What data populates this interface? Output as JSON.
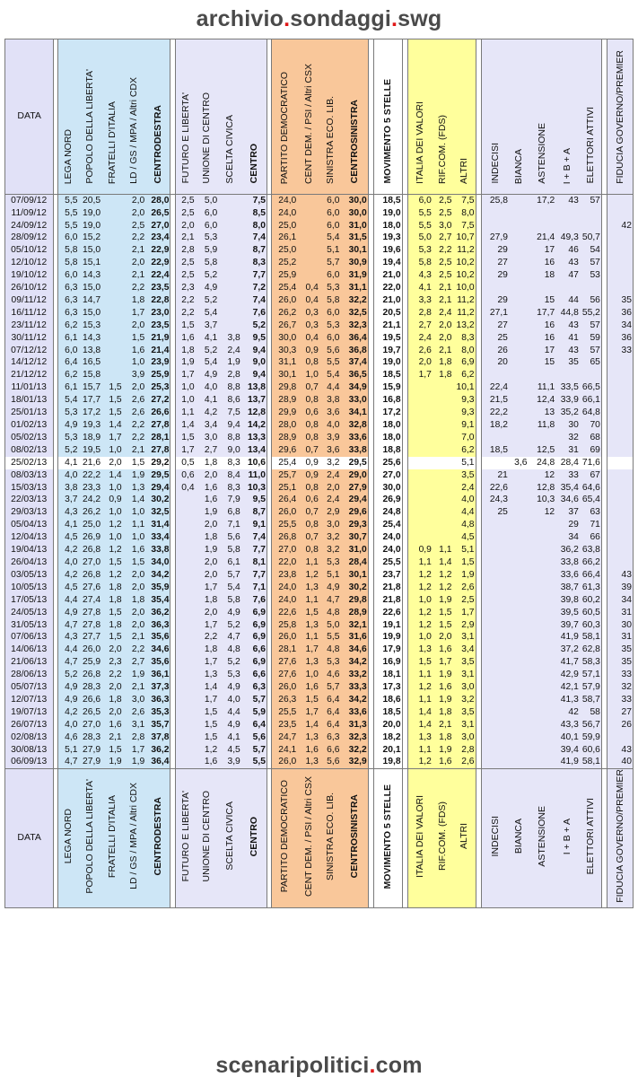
{
  "banner_top": {
    "a": "archivio",
    "dot1": ".",
    "b": "sondaggi",
    "dot2": ".",
    "c": "swg"
  },
  "banner_bottom": {
    "a": "scenaripolitici",
    "dot": ".",
    "b": "com"
  },
  "headers": {
    "date": "DATA",
    "cdx": [
      "LEGA NORD",
      "POPOLO DELLA LIBERTA'",
      "FRATELLI D'ITALIA",
      "LD / GS / MPA / Altri CDX",
      "CENTRODESTRA"
    ],
    "cen": [
      "FUTURO E LIBERTA'",
      "UNIONE DI CENTRO",
      "SCELTA CIVICA",
      "CENTRO"
    ],
    "csx": [
      "PARTITO DEMOCRATICO",
      "CENT DEM. / PSI / Altri CSX",
      "SINISTRA ECO. LIB.",
      "CENTROSINISTRA"
    ],
    "m5s": "MOVIMENTO 5 STELLE",
    "alt": [
      "ITALIA DEI VALORI",
      "RIF.COM. (FDS)",
      "ALTRI"
    ],
    "ast": [
      "INDECISI",
      "BIANCA",
      "ASTENSIONE",
      "I + B + A",
      "ELETTORI ATTIVI"
    ],
    "fid": "FIDUCIA GOVERNO/PREMIER"
  },
  "rows": [
    [
      "07/09/12",
      "5,5",
      "20,5",
      "",
      "2,0",
      "28,0",
      "2,5",
      "5,0",
      "",
      "7,5",
      "24,0",
      "",
      "6,0",
      "30,0",
      "18,5",
      "6,0",
      "2,5",
      "7,5",
      "25,8",
      "",
      "17,2",
      "43",
      "57",
      ""
    ],
    [
      "11/09/12",
      "5,5",
      "19,0",
      "",
      "2,0",
      "26,5",
      "2,5",
      "6,0",
      "",
      "8,5",
      "24,0",
      "",
      "6,0",
      "30,0",
      "19,0",
      "5,5",
      "2,5",
      "8,0",
      "",
      "",
      "",
      "",
      "",
      ""
    ],
    [
      "24/09/12",
      "5,5",
      "19,0",
      "",
      "2,5",
      "27,0",
      "2,0",
      "6,0",
      "",
      "8,0",
      "25,0",
      "",
      "6,0",
      "31,0",
      "18,0",
      "5,5",
      "3,0",
      "7,5",
      "",
      "",
      "",
      "",
      "",
      "42"
    ],
    [
      "28/09/12",
      "6,0",
      "15,2",
      "",
      "2,2",
      "23,4",
      "2,1",
      "5,3",
      "",
      "7,4",
      "26,1",
      "",
      "5,4",
      "31,5",
      "19,3",
      "5,0",
      "2,7",
      "10,7",
      "27,9",
      "",
      "21,4",
      "49,3",
      "50,7",
      ""
    ],
    [
      "05/10/12",
      "5,8",
      "15,0",
      "",
      "2,1",
      "22,9",
      "2,8",
      "5,9",
      "",
      "8,7",
      "25,0",
      "",
      "5,1",
      "30,1",
      "19,6",
      "5,3",
      "2,2",
      "11,2",
      "29",
      "",
      "17",
      "46",
      "54",
      ""
    ],
    [
      "12/10/12",
      "5,8",
      "15,1",
      "",
      "2,0",
      "22,9",
      "2,5",
      "5,8",
      "",
      "8,3",
      "25,2",
      "",
      "5,7",
      "30,9",
      "19,4",
      "5,8",
      "2,5",
      "10,2",
      "27",
      "",
      "16",
      "43",
      "57",
      ""
    ],
    [
      "19/10/12",
      "6,0",
      "14,3",
      "",
      "2,1",
      "22,4",
      "2,5",
      "5,2",
      "",
      "7,7",
      "25,9",
      "",
      "6,0",
      "31,9",
      "21,0",
      "4,3",
      "2,5",
      "10,2",
      "29",
      "",
      "18",
      "47",
      "53",
      ""
    ],
    [
      "26/10/12",
      "6,3",
      "15,0",
      "",
      "2,2",
      "23,5",
      "2,3",
      "4,9",
      "",
      "7,2",
      "25,4",
      "0,4",
      "5,3",
      "31,1",
      "22,0",
      "4,1",
      "2,1",
      "10,0",
      "",
      "",
      "",
      "",
      "",
      ""
    ],
    [
      "09/11/12",
      "6,3",
      "14,7",
      "",
      "1,8",
      "22,8",
      "2,2",
      "5,2",
      "",
      "7,4",
      "26,0",
      "0,4",
      "5,8",
      "32,2",
      "21,0",
      "3,3",
      "2,1",
      "11,2",
      "29",
      "",
      "15",
      "44",
      "56",
      "35"
    ],
    [
      "16/11/12",
      "6,3",
      "15,0",
      "",
      "1,7",
      "23,0",
      "2,2",
      "5,4",
      "",
      "7,6",
      "26,2",
      "0,3",
      "6,0",
      "32,5",
      "20,5",
      "2,8",
      "2,4",
      "11,2",
      "27,1",
      "",
      "17,7",
      "44,8",
      "55,2",
      "36"
    ],
    [
      "23/11/12",
      "6,2",
      "15,3",
      "",
      "2,0",
      "23,5",
      "1,5",
      "3,7",
      "",
      "5,2",
      "26,7",
      "0,3",
      "5,3",
      "32,3",
      "21,1",
      "2,7",
      "2,0",
      "13,2",
      "27",
      "",
      "16",
      "43",
      "57",
      "34"
    ],
    [
      "30/11/12",
      "6,1",
      "14,3",
      "",
      "1,5",
      "21,9",
      "1,6",
      "4,1",
      "3,8",
      "9,5",
      "30,0",
      "0,4",
      "6,0",
      "36,4",
      "19,5",
      "2,4",
      "2,0",
      "8,3",
      "25",
      "",
      "16",
      "41",
      "59",
      "36"
    ],
    [
      "07/12/12",
      "6,0",
      "13,8",
      "",
      "1,6",
      "21,4",
      "1,8",
      "5,2",
      "2,4",
      "9,4",
      "30,3",
      "0,9",
      "5,6",
      "36,8",
      "19,7",
      "2,6",
      "2,1",
      "8,0",
      "26",
      "",
      "17",
      "43",
      "57",
      "33"
    ],
    [
      "14/12/12",
      "6,4",
      "16,5",
      "",
      "1,0",
      "23,9",
      "1,9",
      "5,4",
      "1,9",
      "9,0",
      "31,1",
      "0,8",
      "5,5",
      "37,4",
      "19,0",
      "2,0",
      "1,8",
      "6,9",
      "20",
      "",
      "15",
      "35",
      "65",
      ""
    ],
    [
      "21/12/12",
      "6,2",
      "15,8",
      "",
      "3,9",
      "25,9",
      "1,7",
      "4,9",
      "2,8",
      "9,4",
      "30,1",
      "1,0",
      "5,4",
      "36,5",
      "18,5",
      "1,7",
      "1,8",
      "6,2",
      "",
      "",
      "",
      "",
      "",
      ""
    ],
    [
      "11/01/13",
      "6,1",
      "15,7",
      "1,5",
      "2,0",
      "25,3",
      "1,0",
      "4,0",
      "8,8",
      "13,8",
      "29,8",
      "0,7",
      "4,4",
      "34,9",
      "15,9",
      "",
      "",
      "10,1",
      "22,4",
      "",
      "11,1",
      "33,5",
      "66,5",
      ""
    ],
    [
      "18/01/13",
      "5,4",
      "17,7",
      "1,5",
      "2,6",
      "27,2",
      "1,0",
      "4,1",
      "8,6",
      "13,7",
      "28,9",
      "0,8",
      "3,8",
      "33,0",
      "16,8",
      "",
      "",
      "9,3",
      "21,5",
      "",
      "12,4",
      "33,9",
      "66,1",
      ""
    ],
    [
      "25/01/13",
      "5,3",
      "17,2",
      "1,5",
      "2,6",
      "26,6",
      "1,1",
      "4,2",
      "7,5",
      "12,8",
      "29,9",
      "0,6",
      "3,6",
      "34,1",
      "17,2",
      "",
      "",
      "9,3",
      "22,2",
      "",
      "13",
      "35,2",
      "64,8",
      ""
    ],
    [
      "01/02/13",
      "4,9",
      "19,3",
      "1,4",
      "2,2",
      "27,8",
      "1,4",
      "3,4",
      "9,4",
      "14,2",
      "28,0",
      "0,8",
      "4,0",
      "32,8",
      "18,0",
      "",
      "",
      "9,1",
      "18,2",
      "",
      "11,8",
      "30",
      "70",
      ""
    ],
    [
      "05/02/13",
      "5,3",
      "18,9",
      "1,7",
      "2,2",
      "28,1",
      "1,5",
      "3,0",
      "8,8",
      "13,3",
      "28,9",
      "0,8",
      "3,9",
      "33,6",
      "18,0",
      "",
      "",
      "7,0",
      "",
      "",
      "",
      "32",
      "68",
      ""
    ],
    [
      "08/02/13",
      "5,2",
      "19,5",
      "1,0",
      "2,1",
      "27,8",
      "1,7",
      "2,7",
      "9,0",
      "13,4",
      "29,6",
      "0,7",
      "3,6",
      "33,8",
      "18,8",
      "",
      "",
      "6,2",
      "18,5",
      "",
      "12,5",
      "31",
      "69",
      ""
    ],
    [
      "25/02/13",
      "4,1",
      "21,6",
      "2,0",
      "1,5",
      "29,2",
      "0,5",
      "1,8",
      "8,3",
      "10,6",
      "25,4",
      "0,9",
      "3,2",
      "29,5",
      "25,6",
      "",
      "",
      "5,1",
      "",
      "3,6",
      "24,8",
      "28,4",
      "71,6",
      ""
    ],
    [
      "08/03/13",
      "4,0",
      "22,2",
      "1,4",
      "1,9",
      "29,5",
      "0,6",
      "2,0",
      "8,4",
      "11,0",
      "25,7",
      "0,9",
      "2,4",
      "29,0",
      "27,0",
      "",
      "",
      "3,5",
      "21",
      "",
      "12",
      "33",
      "67",
      ""
    ],
    [
      "15/03/13",
      "3,8",
      "23,3",
      "1,0",
      "1,3",
      "29,4",
      "0,4",
      "1,6",
      "8,3",
      "10,3",
      "25,1",
      "0,8",
      "2,0",
      "27,9",
      "30,0",
      "",
      "",
      "2,4",
      "22,6",
      "",
      "12,8",
      "35,4",
      "64,6",
      ""
    ],
    [
      "22/03/13",
      "3,7",
      "24,2",
      "0,9",
      "1,4",
      "30,2",
      "",
      "1,6",
      "7,9",
      "9,5",
      "26,4",
      "0,6",
      "2,4",
      "29,4",
      "26,9",
      "",
      "",
      "4,0",
      "24,3",
      "",
      "10,3",
      "34,6",
      "65,4",
      ""
    ],
    [
      "29/03/13",
      "4,3",
      "26,2",
      "1,0",
      "1,0",
      "32,5",
      "",
      "1,9",
      "6,8",
      "8,7",
      "26,0",
      "0,7",
      "2,9",
      "29,6",
      "24,8",
      "",
      "",
      "4,4",
      "25",
      "",
      "12",
      "37",
      "63",
      ""
    ],
    [
      "05/04/13",
      "4,1",
      "25,0",
      "1,2",
      "1,1",
      "31,4",
      "",
      "2,0",
      "7,1",
      "9,1",
      "25,5",
      "0,8",
      "3,0",
      "29,3",
      "25,4",
      "",
      "",
      "4,8",
      "",
      "",
      "",
      "29",
      "71",
      ""
    ],
    [
      "12/04/13",
      "4,5",
      "26,9",
      "1,0",
      "1,0",
      "33,4",
      "",
      "1,8",
      "5,6",
      "7,4",
      "26,8",
      "0,7",
      "3,2",
      "30,7",
      "24,0",
      "",
      "",
      "4,5",
      "",
      "",
      "",
      "34",
      "66",
      ""
    ],
    [
      "19/04/13",
      "4,2",
      "26,8",
      "1,2",
      "1,6",
      "33,8",
      "",
      "1,9",
      "5,8",
      "7,7",
      "27,0",
      "0,8",
      "3,2",
      "31,0",
      "24,0",
      "0,9",
      "1,1",
      "5,1",
      "",
      "",
      "",
      "36,2",
      "63,8",
      ""
    ],
    [
      "26/04/13",
      "4,0",
      "27,0",
      "1,5",
      "1,5",
      "34,0",
      "",
      "2,0",
      "6,1",
      "8,1",
      "22,0",
      "1,1",
      "5,3",
      "28,4",
      "25,5",
      "1,1",
      "1,4",
      "1,5",
      "",
      "",
      "",
      "33,8",
      "66,2",
      ""
    ],
    [
      "03/05/13",
      "4,2",
      "26,8",
      "1,2",
      "2,0",
      "34,2",
      "",
      "2,0",
      "5,7",
      "7,7",
      "23,8",
      "1,2",
      "5,1",
      "30,1",
      "23,7",
      "1,2",
      "1,2",
      "1,9",
      "",
      "",
      "",
      "33,6",
      "66,4",
      "43"
    ],
    [
      "10/05/13",
      "4,5",
      "27,6",
      "1,8",
      "2,0",
      "35,9",
      "",
      "1,7",
      "5,4",
      "7,1",
      "24,0",
      "1,3",
      "4,9",
      "30,2",
      "21,8",
      "1,2",
      "1,2",
      "2,6",
      "",
      "",
      "",
      "38,7",
      "61,3",
      "39"
    ],
    [
      "17/05/13",
      "4,4",
      "27,4",
      "1,8",
      "1,8",
      "35,4",
      "",
      "1,8",
      "5,8",
      "7,6",
      "24,0",
      "1,1",
      "4,7",
      "29,8",
      "21,8",
      "1,0",
      "1,9",
      "2,5",
      "",
      "",
      "",
      "39,8",
      "60,2",
      "34"
    ],
    [
      "24/05/13",
      "4,9",
      "27,8",
      "1,5",
      "2,0",
      "36,2",
      "",
      "2,0",
      "4,9",
      "6,9",
      "22,6",
      "1,5",
      "4,8",
      "28,9",
      "22,6",
      "1,2",
      "1,5",
      "1,7",
      "",
      "",
      "",
      "39,5",
      "60,5",
      "31"
    ],
    [
      "31/05/13",
      "4,7",
      "27,8",
      "1,8",
      "2,0",
      "36,3",
      "",
      "1,7",
      "5,2",
      "6,9",
      "25,8",
      "1,3",
      "5,0",
      "32,1",
      "19,1",
      "1,2",
      "1,5",
      "2,9",
      "",
      "",
      "",
      "39,7",
      "60,3",
      "30"
    ],
    [
      "07/06/13",
      "4,3",
      "27,7",
      "1,5",
      "2,1",
      "35,6",
      "",
      "2,2",
      "4,7",
      "6,9",
      "26,0",
      "1,1",
      "5,5",
      "31,6",
      "19,9",
      "1,0",
      "2,0",
      "3,1",
      "",
      "",
      "",
      "41,9",
      "58,1",
      "31"
    ],
    [
      "14/06/13",
      "4,4",
      "26,0",
      "2,0",
      "2,2",
      "34,6",
      "",
      "1,8",
      "4,8",
      "6,6",
      "28,1",
      "1,7",
      "4,8",
      "34,6",
      "17,9",
      "1,3",
      "1,6",
      "3,4",
      "",
      "",
      "",
      "37,2",
      "62,8",
      "35"
    ],
    [
      "21/06/13",
      "4,7",
      "25,9",
      "2,3",
      "2,7",
      "35,6",
      "",
      "1,7",
      "5,2",
      "6,9",
      "27,6",
      "1,3",
      "5,3",
      "34,2",
      "16,9",
      "1,5",
      "1,7",
      "3,5",
      "",
      "",
      "",
      "41,7",
      "58,3",
      "35"
    ],
    [
      "28/06/13",
      "5,2",
      "26,8",
      "2,2",
      "1,9",
      "36,1",
      "",
      "1,3",
      "5,3",
      "6,6",
      "27,6",
      "1,0",
      "4,6",
      "33,2",
      "18,1",
      "1,1",
      "1,9",
      "3,1",
      "",
      "",
      "",
      "42,9",
      "57,1",
      "33"
    ],
    [
      "05/07/13",
      "4,9",
      "28,3",
      "2,0",
      "2,1",
      "37,3",
      "",
      "1,4",
      "4,9",
      "6,3",
      "26,0",
      "1,6",
      "5,7",
      "33,3",
      "17,3",
      "1,2",
      "1,6",
      "3,0",
      "",
      "",
      "",
      "42,1",
      "57,9",
      "32"
    ],
    [
      "12/07/13",
      "4,9",
      "26,6",
      "1,8",
      "3,0",
      "36,3",
      "",
      "1,7",
      "4,0",
      "5,7",
      "26,3",
      "1,5",
      "6,4",
      "34,2",
      "18,6",
      "1,1",
      "1,9",
      "3,2",
      "",
      "",
      "",
      "41,3",
      "58,7",
      "33"
    ],
    [
      "19/07/13",
      "4,2",
      "26,5",
      "2,0",
      "2,6",
      "35,3",
      "",
      "1,5",
      "4,4",
      "5,9",
      "25,5",
      "1,7",
      "6,4",
      "33,6",
      "18,5",
      "1,4",
      "1,8",
      "3,5",
      "",
      "",
      "",
      "42",
      "58",
      "27"
    ],
    [
      "26/07/13",
      "4,0",
      "27,0",
      "1,6",
      "3,1",
      "35,7",
      "",
      "1,5",
      "4,9",
      "6,4",
      "23,5",
      "1,4",
      "6,4",
      "31,3",
      "20,0",
      "1,4",
      "2,1",
      "3,1",
      "",
      "",
      "",
      "43,3",
      "56,7",
      "26"
    ],
    [
      "02/08/13",
      "4,6",
      "28,3",
      "2,1",
      "2,8",
      "37,8",
      "",
      "1,5",
      "4,1",
      "5,6",
      "24,7",
      "1,3",
      "6,3",
      "32,3",
      "18,2",
      "1,3",
      "1,8",
      "3,0",
      "",
      "",
      "",
      "40,1",
      "59,9",
      ""
    ],
    [
      "30/08/13",
      "5,1",
      "27,9",
      "1,5",
      "1,7",
      "36,2",
      "",
      "1,2",
      "4,5",
      "5,7",
      "24,1",
      "1,6",
      "6,6",
      "32,2",
      "20,1",
      "1,1",
      "1,9",
      "2,8",
      "",
      "",
      "",
      "39,4",
      "60,6",
      "43"
    ],
    [
      "06/09/13",
      "4,7",
      "27,9",
      "1,9",
      "1,9",
      "36,4",
      "",
      "1,6",
      "3,9",
      "5,5",
      "26,0",
      "1,3",
      "5,6",
      "32,9",
      "19,8",
      "1,2",
      "1,6",
      "2,6",
      "",
      "",
      "",
      "41,9",
      "58,1",
      "40"
    ]
  ],
  "highlight_row": "25/02/13"
}
